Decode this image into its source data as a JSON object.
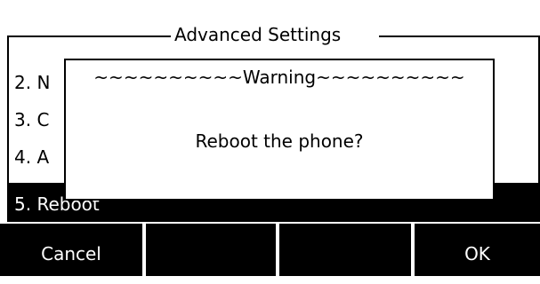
{
  "header": {
    "title": "Advanced Settings"
  },
  "menu": {
    "items": [
      {
        "label": "2. N"
      },
      {
        "label": "3. C"
      },
      {
        "label": "4. A"
      },
      {
        "label": "5. Reboot"
      }
    ],
    "selected_index": 3
  },
  "dialog": {
    "title": "~~~~~~~~~~Warning~~~~~~~~~~",
    "message": "Reboot the phone?"
  },
  "softkeys": [
    {
      "label": "Cancel"
    },
    {
      "label": ""
    },
    {
      "label": ""
    },
    {
      "label": "OK"
    }
  ],
  "colors": {
    "background": "#ffffff",
    "foreground": "#000000",
    "highlight": "#000000",
    "highlight_text": "#ffffff"
  }
}
